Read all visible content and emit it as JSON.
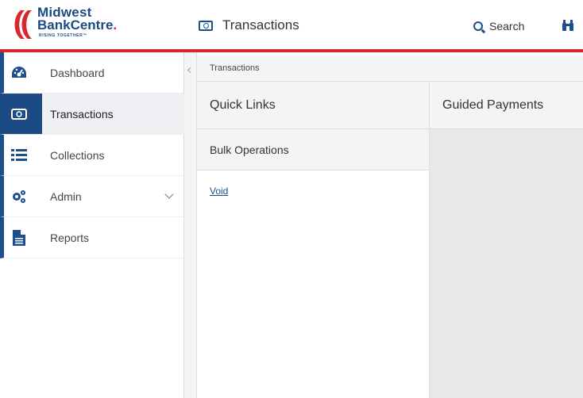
{
  "brand": {
    "name_line1": "Midwest",
    "name_line2": "BankCentre",
    "tagline": "RISING TOGETHER™",
    "red": "#d9262e",
    "blue": "#1c4a84"
  },
  "header": {
    "title": "Transactions",
    "title_icon": "money-icon",
    "search_label": "Search",
    "search_icon": "search-icon",
    "extra_icon": "binoculars-icon"
  },
  "sidebar": {
    "items": [
      {
        "label": "Dashboard",
        "icon": "dashboard-icon",
        "active": false
      },
      {
        "label": "Transactions",
        "icon": "money-icon",
        "active": true
      },
      {
        "label": "Collections",
        "icon": "list-icon",
        "active": false
      },
      {
        "label": "Admin",
        "icon": "gears-icon",
        "active": false,
        "expandable": true
      },
      {
        "label": "Reports",
        "icon": "document-icon",
        "active": false
      }
    ]
  },
  "breadcrumb": "Transactions",
  "quick_links": {
    "title": "Quick Links",
    "section_title": "Bulk Operations",
    "links": [
      "Void"
    ]
  },
  "guided_payments": {
    "title": "Guided Payments"
  }
}
